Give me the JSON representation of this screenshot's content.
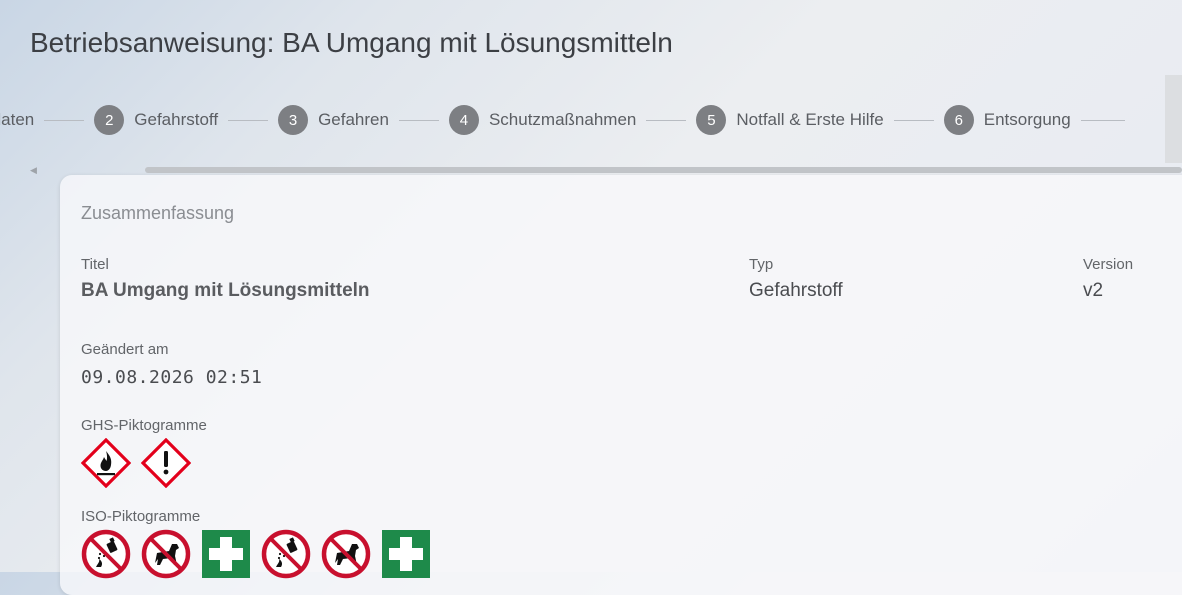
{
  "page": {
    "title": "Betriebsanweisung: BA Umgang mit Lösungsmitteln"
  },
  "stepper": {
    "steps": [
      {
        "number": "",
        "label": "ıdaten"
      },
      {
        "number": "2",
        "label": "Gefahrstoff"
      },
      {
        "number": "3",
        "label": "Gefahren"
      },
      {
        "number": "4",
        "label": "Schutzmaßnahmen"
      },
      {
        "number": "5",
        "label": "Notfall & Erste Hilfe"
      },
      {
        "number": "6",
        "label": "Entsorgung"
      }
    ]
  },
  "summary": {
    "heading": "Zusammenfassung",
    "title_label": "Titel",
    "title_value": "BA Umgang mit Lösungsmitteln",
    "type_label": "Typ",
    "type_value": "Gefahrstoff",
    "version_label": "Version",
    "version_value": "v2",
    "changed_label": "Geändert am",
    "changed_value": "09.08.2026 02:51",
    "ghs_label": "GHS-Piktogramme",
    "ghs_icons": [
      "flame-icon",
      "exclamation-icon"
    ],
    "iso_label": "ISO-Piktogramme",
    "iso_icons": [
      "no-spray-icon",
      "no-dogs-icon",
      "first-aid-icon",
      "no-spray-icon",
      "no-dogs-icon",
      "first-aid-icon"
    ]
  },
  "colors": {
    "ghs_red": "#e3001b",
    "prohibition_red": "#c8102e",
    "first_aid_green": "#1e8a4a",
    "step_circle": "#7d7f83"
  }
}
